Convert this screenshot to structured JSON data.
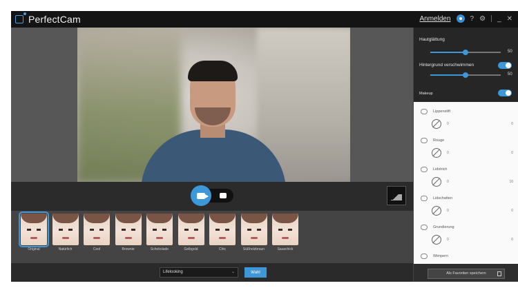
{
  "app": {
    "name": "PerfectCam",
    "signin": "Anmelden",
    "help": "?",
    "settings": "⚙",
    "minimize": "_",
    "close": "✕"
  },
  "filters": [
    {
      "label": "Original",
      "selected": true
    },
    {
      "label": "Natürlich"
    },
    {
      "label": "Cool"
    },
    {
      "label": "Brownie"
    },
    {
      "label": "Schokolade"
    },
    {
      "label": "Gelbgold"
    },
    {
      "label": "Chic"
    },
    {
      "label": "Süßholzbraun"
    },
    {
      "label": "Sauschick"
    }
  ],
  "bottom": {
    "resolution": "Lifelooking",
    "apply_label": "Wahl"
  },
  "panel": {
    "skin_smoothing_label": "Hautglättung",
    "skin_smoothing_value": "50",
    "skin_smoothing_level": 0.5,
    "background_label": "Hintergrund verschwimmen",
    "background_value": "50",
    "background_level": 0.5,
    "makeup_label": "Makeup",
    "makeup_items": [
      {
        "name": "Lippenstift",
        "value": "0",
        "end": "0"
      },
      {
        "name": "Rouge",
        "value": "0",
        "end": "0"
      },
      {
        "name": "Lidstrich",
        "value": "0",
        "end": "10"
      },
      {
        "name": "Lidschatten",
        "value": "0",
        "end": "0"
      },
      {
        "name": "Grundierung",
        "value": "0",
        "end": "0"
      },
      {
        "name": "Wimpern",
        "value": "",
        "end": ""
      }
    ],
    "save_label": "Als Favoriten speichern"
  }
}
